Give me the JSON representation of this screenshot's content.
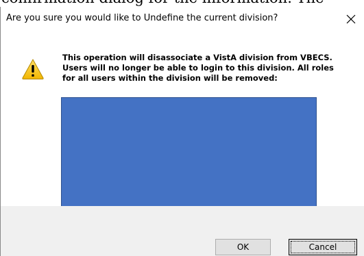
{
  "background": {
    "partial_text": "confirmation dialog for the information. The"
  },
  "dialog": {
    "title": "Are you sure you would like to Undefine the current division?",
    "close_glyph": "✕",
    "icon": "warning-icon",
    "message_lines": [
      "This operation will disassociate a VistA division from VBECS.",
      "Users will no longer be able to login to this division. All roles",
      "for all users within the division will be removed:"
    ],
    "detail_box_color": "#4472c4",
    "buttons": {
      "ok": "OK",
      "cancel": "Cancel"
    }
  }
}
